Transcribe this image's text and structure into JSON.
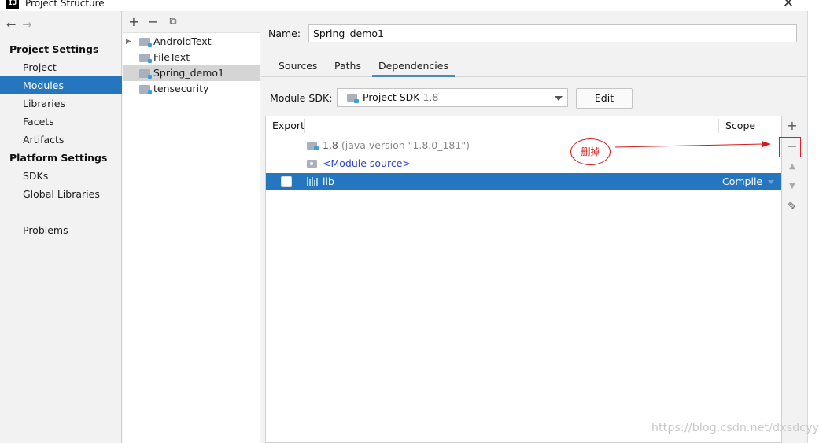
{
  "window": {
    "title": "Project Structure",
    "app_icon": "IJ",
    "close_glyph": "✕"
  },
  "nav": {
    "back_glyph": "←",
    "forward_glyph": "→",
    "section_project": "Project Settings",
    "section_platform": "Platform Settings",
    "items": [
      "Project",
      "Modules",
      "Libraries",
      "Facets",
      "Artifacts"
    ],
    "platform_items": [
      "SDKs",
      "Global Libraries"
    ],
    "problems": "Problems",
    "selected": "Modules"
  },
  "modules": {
    "toolbar": {
      "add": "+",
      "remove": "−",
      "copy": "⧉"
    },
    "expand_glyph": "▶",
    "items": [
      "AndroidText",
      "FileText",
      "Spring_demo1",
      "tensecurity"
    ],
    "selected": "Spring_demo1"
  },
  "detail": {
    "name_label": "Name:",
    "name_value": "Spring_demo1",
    "tabs": [
      "Sources",
      "Paths",
      "Dependencies"
    ],
    "active_tab": "Dependencies",
    "sdk_label": "Module SDK:",
    "sdk_value": "Project SDK",
    "sdk_version": "1.8",
    "edit_label": "Edit"
  },
  "dependencies": {
    "headers": {
      "export": "Export",
      "scope": "Scope"
    },
    "rows": [
      {
        "name": "1.8",
        "detail": " (java version \"1.8.0_181\")"
      },
      {
        "name": "<Module source>"
      },
      {
        "name": "lib",
        "scope": "Compile"
      }
    ],
    "side_toolbar": {
      "add": "+",
      "remove": "−",
      "up": "▲",
      "down": "▼",
      "edit": "✎"
    }
  },
  "annotation": {
    "text": "删掉",
    "color": "#d61a1a"
  },
  "watermark": "https://blog.csdn.net/dxsdcyy",
  "colors": {
    "selection": "#2675bf",
    "tab_underline": "#4a88c7",
    "module_source": "#2a3fdc"
  }
}
